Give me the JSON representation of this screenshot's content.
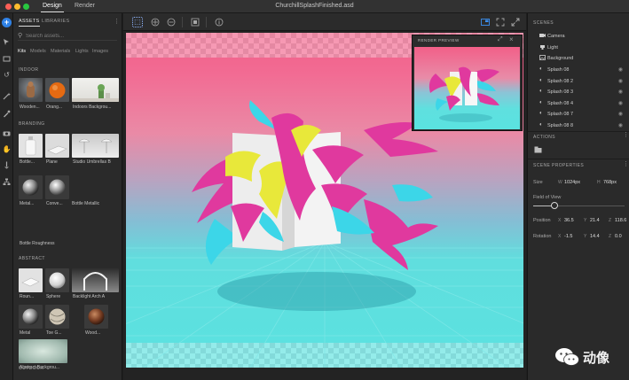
{
  "window": {
    "title": "ChurchillSplashFinished.asd",
    "modes": [
      "Design",
      "Render"
    ],
    "active_mode": "Design"
  },
  "toolstrip": {
    "icons": [
      "add-icon",
      "select-icon",
      "frame-icon",
      "undo-icon",
      "magic-wand-icon",
      "eyedropper-icon",
      "camera-icon",
      "hand-icon",
      "drop-icon",
      "hierarchy-icon"
    ]
  },
  "assets_panel": {
    "tabs": [
      "ASSETS",
      "LIBRARIES"
    ],
    "search_placeholder": "Search assets...",
    "filters": [
      "Kits",
      "Models",
      "Materials",
      "Lights",
      "Images"
    ],
    "sections": [
      {
        "title": "INDOOR",
        "items": [
          "Wooden...",
          "Orang...",
          "Indoors Backgrou..."
        ]
      },
      {
        "title": "BRANDING",
        "items": [
          "Bottle...",
          "Plane",
          "Studio Umbrellas B",
          "Metal...",
          "Conve...",
          "Bottle Metallic",
          "Bottle Roughness"
        ]
      },
      {
        "title": "ABSTRACT",
        "items": [
          "Roun...",
          "Sphere",
          "Backlight Arch A",
          "Metal",
          "Toe G...",
          "Wood...",
          "Abstract Backgrou..."
        ]
      },
      {
        "title": "OUTDOOR",
        "items": []
      }
    ]
  },
  "canvas": {
    "toolbar_icons": [
      "marquee-select-icon",
      "move-icon",
      "rotate-icon",
      "snap-icon",
      "info-icon",
      "render-view-icon",
      "fit-icon",
      "fullscreen-icon"
    ]
  },
  "render_preview": {
    "title": "RENDER PREVIEW"
  },
  "scenes_panel": {
    "title": "SCENES",
    "items": [
      {
        "icon": "camera-icon",
        "label": "Camera"
      },
      {
        "icon": "light-icon",
        "label": "Light"
      },
      {
        "icon": "image-icon",
        "label": "Background"
      },
      {
        "icon": "mesh-icon",
        "label": "Splash 08"
      },
      {
        "icon": "mesh-icon",
        "label": "Splash 08 2"
      },
      {
        "icon": "mesh-icon",
        "label": "Splash 08 3"
      },
      {
        "icon": "mesh-icon",
        "label": "Splash 08 4"
      },
      {
        "icon": "mesh-icon",
        "label": "Splash 08 7"
      },
      {
        "icon": "mesh-icon",
        "label": "Splash 08 8"
      }
    ],
    "actions_title": "ACTIONS",
    "properties_title": "SCENE PROPERTIES",
    "size_label": "Size",
    "width_axis": "W",
    "width_value": "1024px",
    "height_axis": "H",
    "height_value": "768px",
    "fov_label": "Field of View",
    "fov_level": 0.23,
    "position_label": "Position",
    "position": {
      "x": "36.5",
      "y": "21.4",
      "z": "118.6"
    },
    "rotation_label": "Rotation",
    "rotation": {
      "x": "-1.5",
      "y": "14.4",
      "z": "0.0"
    },
    "axis_x": "X",
    "axis_y": "Y",
    "axis_z": "Z"
  },
  "watermark": {
    "text": "动像"
  },
  "colors": {
    "accent": "#2f82e6",
    "panel": "#2a2a2a",
    "sky_top": "#f25f88",
    "floor": "#5ae2e0",
    "splash_magenta": "#e0399e",
    "splash_yellow": "#e8e83a",
    "splash_cyan": "#3cd6e8"
  }
}
